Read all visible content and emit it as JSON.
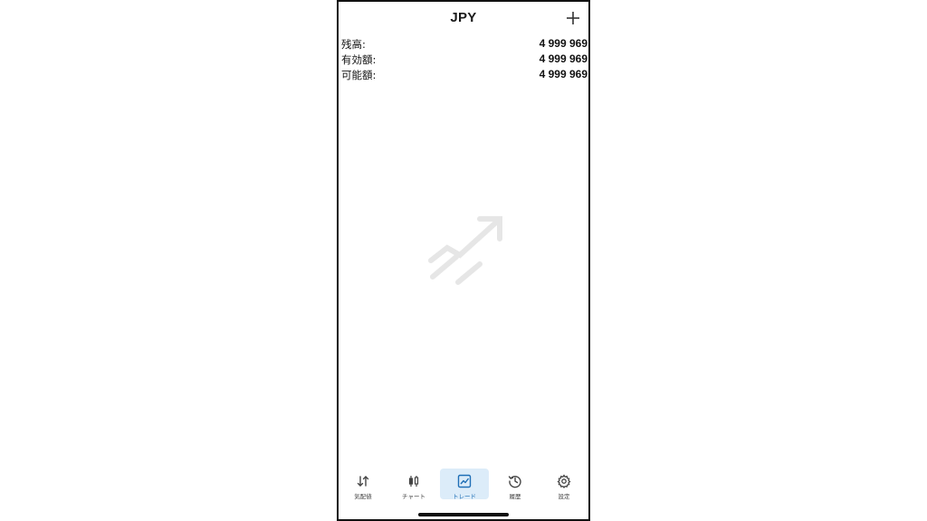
{
  "header": {
    "title": "JPY",
    "add_icon": "plus-icon"
  },
  "balances": [
    {
      "label": "残高:",
      "value": "4 999 969"
    },
    {
      "label": "有効額:",
      "value": "4 999 969"
    },
    {
      "label": "可能額:",
      "value": "4 999 969"
    }
  ],
  "empty_state": {
    "icon": "trending-up-illustration"
  },
  "tabs": [
    {
      "label": "気配値",
      "icon": "arrows-up-down-icon",
      "active": false
    },
    {
      "label": "チャート",
      "icon": "candlestick-icon",
      "active": false
    },
    {
      "label": "トレード",
      "icon": "line-chart-icon",
      "active": true
    },
    {
      "label": "履歴",
      "icon": "history-clock-icon",
      "active": false
    },
    {
      "label": "設定",
      "icon": "gear-icon",
      "active": false
    }
  ],
  "colors": {
    "accent": "#1f6fb6",
    "active_tab_bg": "#dcecf9",
    "illustration": "#e6e6e6"
  }
}
